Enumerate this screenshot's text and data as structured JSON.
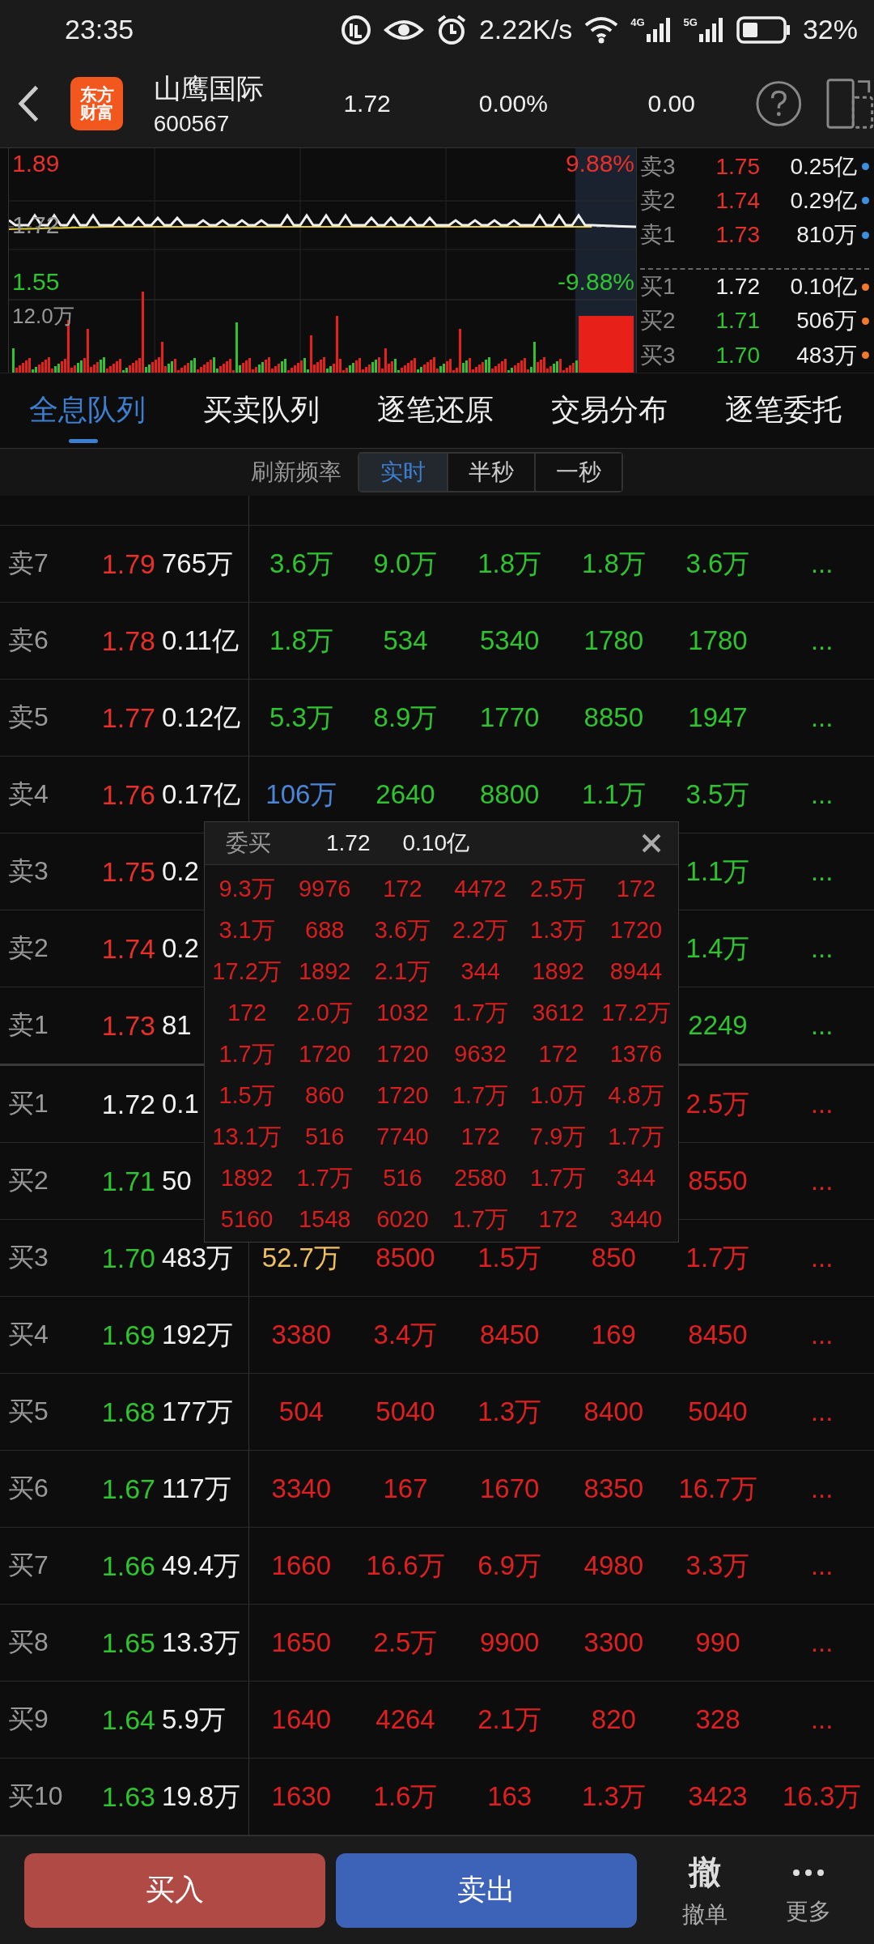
{
  "status_bar": {
    "time": "23:35",
    "net_speed": "2.22K/s",
    "signal_labels": [
      "4G",
      "5G"
    ],
    "battery": "32%"
  },
  "header": {
    "logo": [
      "东方",
      "财富"
    ],
    "name": "山鹰国际",
    "code": "600567",
    "price": "1.72",
    "change_pct": "0.00%",
    "change": "0.00"
  },
  "chart": {
    "high": "1.89",
    "high_pct": "9.88%",
    "prev_close": "1.72",
    "low": "1.55",
    "low_pct": "-9.88%",
    "volume_max": "12.0万"
  },
  "order_book": [
    {
      "label": "卖3",
      "price": "1.75",
      "volume": "0.25亿",
      "kind": "ask",
      "color": "#e8302a"
    },
    {
      "label": "卖2",
      "price": "1.74",
      "volume": "0.29亿",
      "kind": "ask",
      "color": "#e8302a"
    },
    {
      "label": "卖1",
      "price": "1.73",
      "volume": "810万",
      "kind": "ask",
      "color": "#e8302a"
    },
    {
      "label": "买1",
      "price": "1.72",
      "volume": "0.10亿",
      "kind": "bid",
      "color": "#f2f2f2"
    },
    {
      "label": "买2",
      "price": "1.71",
      "volume": "506万",
      "kind": "bid",
      "color": "#2fc42f"
    },
    {
      "label": "买3",
      "price": "1.70",
      "volume": "483万",
      "kind": "bid",
      "color": "#2fc42f"
    }
  ],
  "tabs": [
    {
      "label": "全息队列",
      "selected": true
    },
    {
      "label": "买卖队列",
      "selected": false
    },
    {
      "label": "逐笔还原",
      "selected": false
    },
    {
      "label": "交易分布",
      "selected": false
    },
    {
      "label": "逐笔委托",
      "selected": false
    }
  ],
  "refresh": {
    "label": "刷新频率",
    "options": [
      {
        "label": "实时",
        "selected": true
      },
      {
        "label": "半秒",
        "selected": false
      },
      {
        "label": "一秒",
        "selected": false
      }
    ]
  },
  "queue_rows": [
    {
      "label": "卖7",
      "price": "1.79",
      "color": "#e8302a",
      "kind": "sell",
      "volume": "765万",
      "cells": [
        "3.6万",
        "9.0万",
        "1.8万",
        "1.8万",
        "3.6万",
        "..."
      ]
    },
    {
      "label": "卖6",
      "price": "1.78",
      "color": "#e8302a",
      "kind": "sell",
      "volume": "0.11亿",
      "cells": [
        "1.8万",
        "534",
        "5340",
        "1780",
        "1780",
        "..."
      ]
    },
    {
      "label": "卖5",
      "price": "1.77",
      "color": "#e8302a",
      "kind": "sell",
      "volume": "0.12亿",
      "cells": [
        "5.3万",
        "8.9万",
        "1770",
        "8850",
        "1947",
        "..."
      ]
    },
    {
      "label": "卖4",
      "price": "1.76",
      "color": "#e8302a",
      "kind": "sell",
      "volume": "0.17亿",
      "cells": [
        {
          "text": "106万",
          "color": "#4a86d8"
        },
        "2640",
        "8800",
        "1.1万",
        "3.5万",
        "..."
      ]
    },
    {
      "label": "卖3",
      "price": "1.75",
      "color": "#e8302a",
      "kind": "sell",
      "volume": "0.2",
      "cells": [
        null,
        null,
        null,
        null,
        "1.1万",
        "..."
      ]
    },
    {
      "label": "卖2",
      "price": "1.74",
      "color": "#e8302a",
      "kind": "sell",
      "volume": "0.2",
      "cells": [
        null,
        null,
        null,
        null,
        "1.4万",
        "..."
      ]
    },
    {
      "label": "卖1",
      "price": "1.73",
      "color": "#e8302a",
      "kind": "sell",
      "volume": "81",
      "cells": [
        null,
        null,
        null,
        null,
        "2249",
        "..."
      ]
    },
    {
      "label": "买1",
      "price": "1.72",
      "color": "#f2f2f2",
      "kind": "buy",
      "volume": "0.1",
      "cells": [
        null,
        null,
        null,
        null,
        "2.5万",
        "..."
      ]
    },
    {
      "label": "买2",
      "price": "1.71",
      "color": "#2fc42f",
      "kind": "buy",
      "volume": "50",
      "cells": [
        null,
        null,
        null,
        null,
        "8550",
        "..."
      ]
    },
    {
      "label": "买3",
      "price": "1.70",
      "color": "#2fc42f",
      "kind": "buy",
      "volume": "483万",
      "cells": [
        {
          "text": "52.7万",
          "color": "#f0c060"
        },
        "8500",
        "1.5万",
        "850",
        "1.7万",
        "..."
      ]
    },
    {
      "label": "买4",
      "price": "1.69",
      "color": "#2fc42f",
      "kind": "buy",
      "volume": "192万",
      "cells": [
        "3380",
        "3.4万",
        "8450",
        "169",
        "8450",
        "..."
      ]
    },
    {
      "label": "买5",
      "price": "1.68",
      "color": "#2fc42f",
      "kind": "buy",
      "volume": "177万",
      "cells": [
        "504",
        "5040",
        "1.3万",
        "8400",
        "5040",
        "..."
      ]
    },
    {
      "label": "买6",
      "price": "1.67",
      "color": "#2fc42f",
      "kind": "buy",
      "volume": "117万",
      "cells": [
        "3340",
        "167",
        "1670",
        "8350",
        "16.7万",
        "..."
      ]
    },
    {
      "label": "买7",
      "price": "1.66",
      "color": "#2fc42f",
      "kind": "buy",
      "volume": "49.4万",
      "cells": [
        "1660",
        "16.6万",
        "6.9万",
        "4980",
        "3.3万",
        "..."
      ]
    },
    {
      "label": "买8",
      "price": "1.65",
      "color": "#2fc42f",
      "kind": "buy",
      "volume": "13.3万",
      "cells": [
        "1650",
        "2.5万",
        "9900",
        "3300",
        "990",
        "..."
      ]
    },
    {
      "label": "买9",
      "price": "1.64",
      "color": "#2fc42f",
      "kind": "buy",
      "volume": "5.9万",
      "cells": [
        "1640",
        "4264",
        "2.1万",
        "820",
        "328",
        "..."
      ]
    },
    {
      "label": "买10",
      "price": "1.63",
      "color": "#2fc42f",
      "kind": "buy",
      "volume": "19.8万",
      "cells": [
        "1630",
        "1.6万",
        "163",
        "1.3万",
        "3423",
        "16.3万"
      ]
    }
  ],
  "popup": {
    "title": "委买",
    "price": "1.72",
    "volume": "0.10亿",
    "rows": [
      [
        "9.3万",
        "9976",
        "172",
        "4472",
        "2.5万",
        "172"
      ],
      [
        "3.1万",
        "688",
        "3.6万",
        "2.2万",
        "1.3万",
        "1720"
      ],
      [
        "17.2万",
        "1892",
        "2.1万",
        "344",
        "1892",
        "8944"
      ],
      [
        "172",
        "2.0万",
        "1032",
        "1.7万",
        "3612",
        "17.2万"
      ],
      [
        "1.7万",
        "1720",
        "1720",
        "9632",
        "172",
        "1376"
      ],
      [
        "1.5万",
        "860",
        "1720",
        "1.7万",
        "1.0万",
        "4.8万"
      ],
      [
        "13.1万",
        "516",
        "7740",
        "172",
        "7.9万",
        "1.7万"
      ],
      [
        "1892",
        "1.7万",
        "516",
        "2580",
        "1.7万",
        "344"
      ],
      [
        "5160",
        "1548",
        "6020",
        "1.7万",
        "172",
        "3440"
      ]
    ]
  },
  "bottom_bar": {
    "buy": "买入",
    "sell": "卖出",
    "cancel_glyph": "撤",
    "cancel_label": "撤单",
    "more_label": "更多"
  }
}
